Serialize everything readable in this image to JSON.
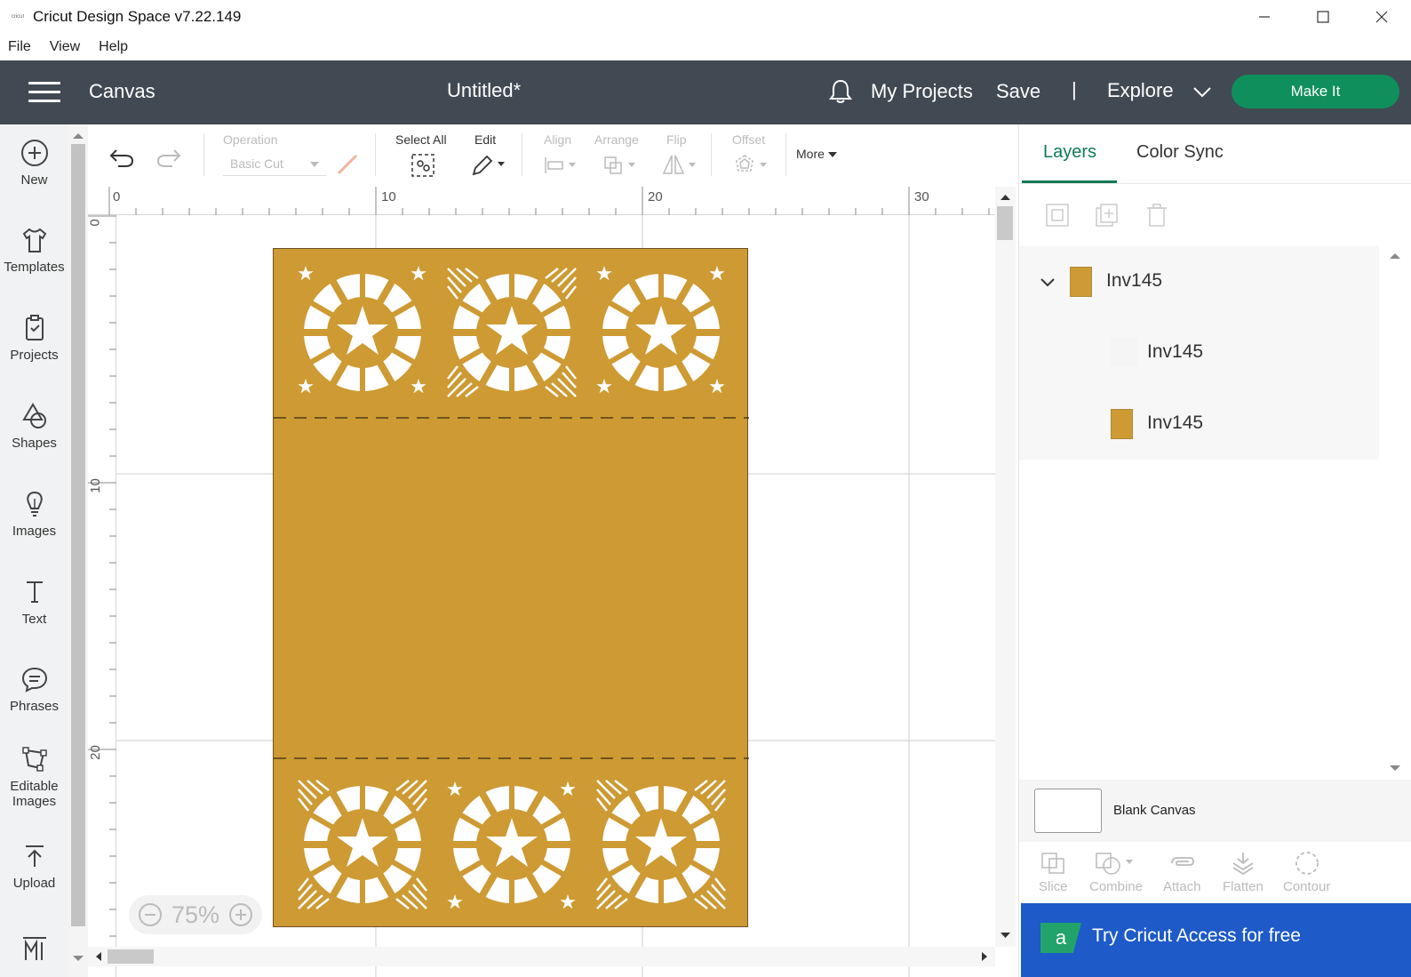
{
  "window": {
    "logo_text": "cricut",
    "title": "Cricut Design Space  v7.22.149"
  },
  "menu": [
    "File",
    "View",
    "Help"
  ],
  "header": {
    "section": "Canvas",
    "project_title": "Untitled*",
    "my_projects": "My Projects",
    "save": "Save",
    "separator": "|",
    "explore": "Explore",
    "make_it": "Make It"
  },
  "sidebar": [
    {
      "label": "New",
      "icon": "plus-circle-icon"
    },
    {
      "label": "Templates",
      "icon": "shirt-icon"
    },
    {
      "label": "Projects",
      "icon": "clipboard-icon"
    },
    {
      "label": "Shapes",
      "icon": "shapes-icon"
    },
    {
      "label": "Images",
      "icon": "bulb-icon"
    },
    {
      "label": "Text",
      "icon": "text-icon"
    },
    {
      "label": "Phrases",
      "icon": "speech-bubble-icon"
    },
    {
      "label": "Editable Images",
      "icon": "edit-nodes-icon"
    },
    {
      "label": "Upload",
      "icon": "upload-icon"
    }
  ],
  "toolbar": {
    "operation_label": "Operation",
    "operation_value": "Basic Cut",
    "select_all": "Select All",
    "edit": "Edit",
    "align": "Align",
    "arrange": "Arrange",
    "flip": "Flip",
    "offset": "Offset",
    "more": "More"
  },
  "rulers": {
    "top": [
      "0",
      "10",
      "20",
      "30"
    ],
    "left": [
      "0",
      "10",
      "20"
    ]
  },
  "zoom": {
    "level": "75%"
  },
  "design": {
    "fill_color": "#cd9a33"
  },
  "layers_panel": {
    "tabs": [
      "Layers",
      "Color Sync"
    ],
    "group": {
      "name": "Inv145"
    },
    "items": [
      {
        "name": "Inv145"
      },
      {
        "name": "Inv145"
      }
    ],
    "blank_canvas": "Blank Canvas",
    "tools": [
      "Slice",
      "Combine",
      "Attach",
      "Flatten",
      "Contour"
    ],
    "banner": "Try Cricut Access for free"
  }
}
